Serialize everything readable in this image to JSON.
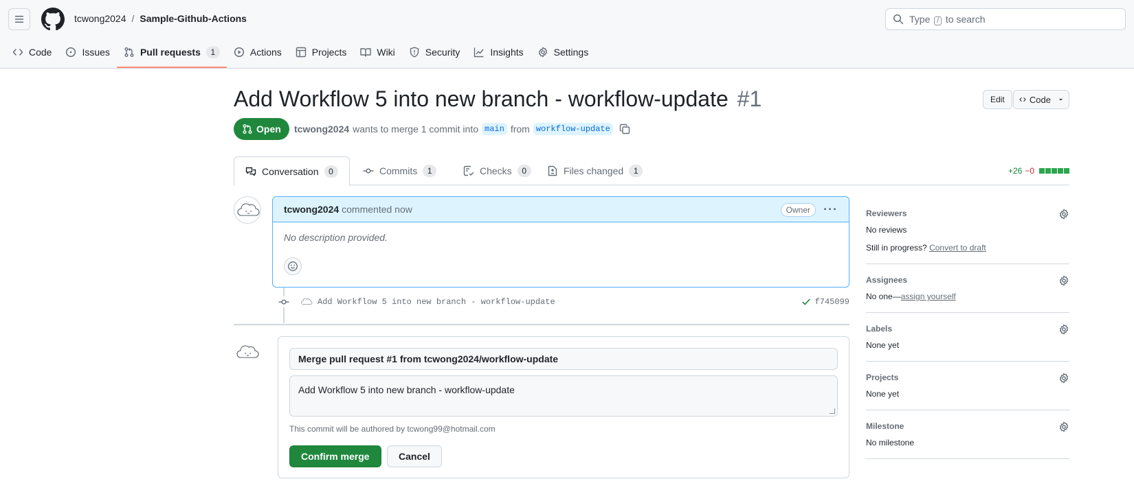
{
  "header": {
    "repo_owner": "tcwong2024",
    "repo_sep": "/",
    "repo_name": "Sample-Github-Actions",
    "search_prefix": "Type",
    "search_key": "/",
    "search_suffix": "to search"
  },
  "nav": {
    "items": [
      {
        "label": "Code",
        "icon": "code-icon"
      },
      {
        "label": "Issues",
        "icon": "issue-opened-icon"
      },
      {
        "label": "Pull requests",
        "icon": "git-pull-request-icon",
        "count": "1"
      },
      {
        "label": "Actions",
        "icon": "play-icon"
      },
      {
        "label": "Projects",
        "icon": "table-icon"
      },
      {
        "label": "Wiki",
        "icon": "book-icon"
      },
      {
        "label": "Security",
        "icon": "shield-icon"
      },
      {
        "label": "Insights",
        "icon": "graph-icon"
      },
      {
        "label": "Settings",
        "icon": "gear-icon"
      }
    ]
  },
  "pr": {
    "title": "Add Workflow 5 into new branch - workflow-update",
    "number": "#1",
    "edit_label": "Edit",
    "code_label": "Code",
    "state": "Open",
    "author": "tcwong2024",
    "meta_text": "wants to merge 1 commit into",
    "base_branch": "main",
    "from_text": "from",
    "head_branch": "workflow-update"
  },
  "tabs": [
    {
      "label": "Conversation",
      "count": "0"
    },
    {
      "label": "Commits",
      "count": "1"
    },
    {
      "label": "Checks",
      "count": "0"
    },
    {
      "label": "Files changed",
      "count": "1"
    }
  ],
  "diffstat": {
    "additions": "+26",
    "deletions": "−0"
  },
  "comment": {
    "author": "tcwong2024",
    "action": "commented now",
    "badge": "Owner",
    "body": "No description provided."
  },
  "commit": {
    "message": "Add Workflow 5 into new branch - workflow-update",
    "sha": "f745099"
  },
  "merge": {
    "title_value": "Merge pull request #1 from tcwong2024/workflow-update",
    "body_value": "Add Workflow 5 into new branch - workflow-update",
    "author_note": "This commit will be authored by tcwong99@hotmail.com",
    "confirm_label": "Confirm merge",
    "cancel_label": "Cancel"
  },
  "sidebar": {
    "reviewers": {
      "title": "Reviewers",
      "value": "No reviews",
      "progress_text": "Still in progress?",
      "draft_link": "Convert to draft"
    },
    "assignees": {
      "title": "Assignees",
      "value_prefix": "No one—",
      "assign_link": "assign yourself"
    },
    "labels": {
      "title": "Labels",
      "value": "None yet"
    },
    "projects": {
      "title": "Projects",
      "value": "None yet"
    },
    "milestone": {
      "title": "Milestone",
      "value": "No milestone"
    }
  },
  "colors": {
    "accent": "#0969da",
    "success": "#1f883d",
    "nav_underline": "#fd8c73",
    "comment_header": "#ddf4ff"
  }
}
